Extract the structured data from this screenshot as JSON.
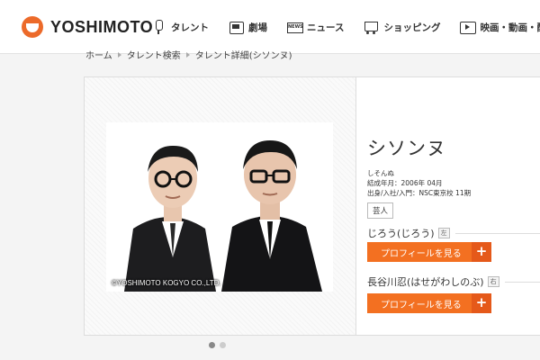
{
  "header": {
    "logo_text": "YOSHIMOTO",
    "nav": [
      {
        "label": "タレント",
        "icon": "microphone-icon"
      },
      {
        "label": "劇場",
        "icon": "theater-icon"
      },
      {
        "label": "ニュース",
        "icon": "news-icon"
      },
      {
        "label": "ショッピング",
        "icon": "shopping-cart-icon"
      },
      {
        "label": "映画・動画・配信",
        "icon": "movie-icon"
      }
    ]
  },
  "breadcrumb": [
    "ホーム",
    "タレント検索",
    "タレント詳細(シソンヌ)"
  ],
  "talent": {
    "name": "シソンヌ",
    "reading": "しそんぬ",
    "formed": "結成年月：2006年 04月",
    "origin": "出身/入社/入門：NSC東京校 11期",
    "tag": "芸人",
    "photo_copyright": "©YOSHIMOTO KOGYO CO.,LTD.",
    "members": [
      {
        "name": "じろう(じろう)",
        "position": "左",
        "button_label": "プロフィールを見る",
        "button_plus": "+"
      },
      {
        "name": "長谷川忍(はせがわしのぶ)",
        "position": "右",
        "button_label": "プロフィールを見る",
        "button_plus": "+"
      }
    ]
  },
  "carousel": {
    "current_page": 1,
    "total_pages": 2
  },
  "colors": {
    "accent": "#f37021",
    "logo": "#ec6a2a"
  }
}
